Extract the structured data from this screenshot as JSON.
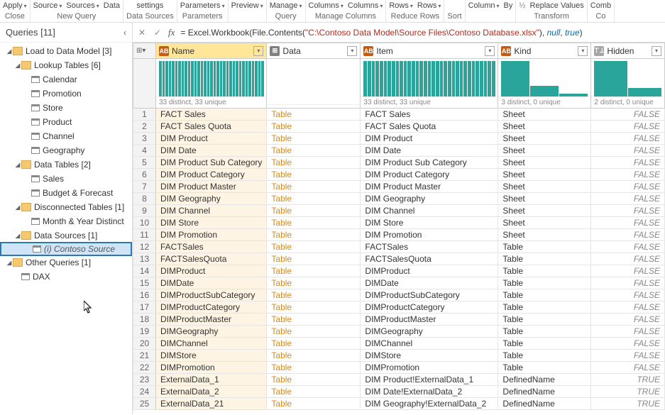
{
  "ribbon": {
    "groups": [
      {
        "top": [
          "Apply"
        ],
        "top_dd": [
          true
        ],
        "bottom": "Close"
      },
      {
        "top": [
          "Source",
          "Sources",
          "Data"
        ],
        "top_dd": [
          true,
          true,
          false
        ],
        "bottom": "New Query"
      },
      {
        "top": [
          "settings"
        ],
        "top_dd": [
          false
        ],
        "bottom": "Data Sources"
      },
      {
        "top": [
          "Parameters"
        ],
        "top_dd": [
          true
        ],
        "bottom": "Parameters"
      },
      {
        "top": [
          "Preview"
        ],
        "top_dd": [
          true
        ],
        "bottom": ""
      },
      {
        "top": [
          "Manage"
        ],
        "top_dd": [
          true
        ],
        "bottom": "Query"
      },
      {
        "top": [
          "Columns",
          "Columns"
        ],
        "top_dd": [
          true,
          true
        ],
        "bottom": "Manage Columns"
      },
      {
        "top": [
          "Rows",
          "Rows"
        ],
        "top_dd": [
          true,
          true
        ],
        "bottom": "Reduce Rows"
      },
      {
        "top": [
          ""
        ],
        "top_dd": [
          false
        ],
        "bottom": "Sort"
      },
      {
        "top": [
          "Column",
          "By"
        ],
        "top_dd": [
          true,
          false
        ],
        "bottom": ""
      },
      {
        "top": [
          "Replace Values"
        ],
        "top_dd": [
          false
        ],
        "bottom": "Transform",
        "prefix": "½"
      },
      {
        "top": [
          "Comb"
        ],
        "top_dd": [
          false
        ],
        "bottom": "Co"
      }
    ]
  },
  "queries_header": "Queries [11]",
  "tree": [
    {
      "level": 0,
      "type": "folder",
      "expanded": true,
      "label": "Load to Data Model [3]"
    },
    {
      "level": 1,
      "type": "folder",
      "expanded": true,
      "label": "Lookup Tables [6]"
    },
    {
      "level": 2,
      "type": "table",
      "label": "Calendar"
    },
    {
      "level": 2,
      "type": "table",
      "label": "Promotion"
    },
    {
      "level": 2,
      "type": "table",
      "label": "Store"
    },
    {
      "level": 2,
      "type": "table",
      "label": "Product"
    },
    {
      "level": 2,
      "type": "table",
      "label": "Channel"
    },
    {
      "level": 2,
      "type": "table",
      "label": "Geography"
    },
    {
      "level": 1,
      "type": "folder",
      "expanded": true,
      "label": "Data Tables [2]"
    },
    {
      "level": 2,
      "type": "table",
      "label": "Sales"
    },
    {
      "level": 2,
      "type": "table",
      "label": "Budget & Forecast"
    },
    {
      "level": 1,
      "type": "folder",
      "expanded": true,
      "label": "Disconnected Tables [1]"
    },
    {
      "level": 2,
      "type": "table",
      "label": "Month & Year Distinct"
    },
    {
      "level": 1,
      "type": "folder",
      "expanded": true,
      "label": "Data Sources [1]"
    },
    {
      "level": 2,
      "type": "table",
      "label": "(i) Contoso Source",
      "selected": true,
      "italic": true
    },
    {
      "level": 0,
      "type": "folder",
      "expanded": true,
      "label": "Other Queries [1]"
    },
    {
      "level": 1,
      "type": "table",
      "label": "DAX"
    }
  ],
  "formula": {
    "prefix": "= Excel.Workbook(File.Contents(",
    "string": "\"C:\\Contoso Data Model\\Source Files\\Contoso Database.xlsx\"",
    "mid": "), ",
    "null": "null",
    "sep": ", ",
    "true": "true",
    "suffix": ")"
  },
  "columns": [
    {
      "key": "name",
      "label": "Name",
      "type": "abc",
      "type_text": "AB",
      "selected": true
    },
    {
      "key": "data",
      "label": "Data",
      "type": "any",
      "type_text": "⊞"
    },
    {
      "key": "item",
      "label": "Item",
      "type": "abc",
      "type_text": "AB"
    },
    {
      "key": "kind",
      "label": "Kind",
      "type": "abc",
      "type_text": "AB"
    },
    {
      "key": "hidden",
      "label": "Hidden",
      "type": "bool",
      "type_text": "⊤⊥"
    }
  ],
  "histograms": {
    "name": {
      "caption": "33 distinct, 33 unique",
      "bars": 33,
      "heights": "full"
    },
    "data": {
      "caption": "",
      "bars": 0
    },
    "item": {
      "caption": "33 distinct, 33 unique",
      "bars": 33,
      "heights": "full"
    },
    "kind": {
      "caption": "3 distinct, 0 unique",
      "bars": 3,
      "heights": [
        50,
        15,
        4
      ]
    },
    "hidden": {
      "caption": "2 distinct, 0 unique",
      "bars": 2,
      "heights": [
        50,
        12
      ]
    }
  },
  "rows": [
    {
      "n": 1,
      "name": "FACT Sales",
      "data": "Table",
      "item": "FACT Sales",
      "kind": "Sheet",
      "hidden": "FALSE"
    },
    {
      "n": 2,
      "name": "FACT Sales Quota",
      "data": "Table",
      "item": "FACT Sales Quota",
      "kind": "Sheet",
      "hidden": "FALSE"
    },
    {
      "n": 3,
      "name": "DIM Product",
      "data": "Table",
      "item": "DIM Product",
      "kind": "Sheet",
      "hidden": "FALSE"
    },
    {
      "n": 4,
      "name": "DIM Date",
      "data": "Table",
      "item": "DIM Date",
      "kind": "Sheet",
      "hidden": "FALSE"
    },
    {
      "n": 5,
      "name": "DIM Product Sub Category",
      "data": "Table",
      "item": "DIM Product Sub Category",
      "kind": "Sheet",
      "hidden": "FALSE"
    },
    {
      "n": 6,
      "name": "DIM Product Category",
      "data": "Table",
      "item": "DIM Product Category",
      "kind": "Sheet",
      "hidden": "FALSE"
    },
    {
      "n": 7,
      "name": "DIM Product Master",
      "data": "Table",
      "item": "DIM Product Master",
      "kind": "Sheet",
      "hidden": "FALSE"
    },
    {
      "n": 8,
      "name": "DIM Geography",
      "data": "Table",
      "item": "DIM Geography",
      "kind": "Sheet",
      "hidden": "FALSE"
    },
    {
      "n": 9,
      "name": "DIM Channel",
      "data": "Table",
      "item": "DIM Channel",
      "kind": "Sheet",
      "hidden": "FALSE"
    },
    {
      "n": 10,
      "name": "DIM Store",
      "data": "Table",
      "item": "DIM Store",
      "kind": "Sheet",
      "hidden": "FALSE"
    },
    {
      "n": 11,
      "name": "DIM Promotion",
      "data": "Table",
      "item": "DIM Promotion",
      "kind": "Sheet",
      "hidden": "FALSE"
    },
    {
      "n": 12,
      "name": "FACTSales",
      "data": "Table",
      "item": "FACTSales",
      "kind": "Table",
      "hidden": "FALSE"
    },
    {
      "n": 13,
      "name": "FACTSalesQuota",
      "data": "Table",
      "item": "FACTSalesQuota",
      "kind": "Table",
      "hidden": "FALSE"
    },
    {
      "n": 14,
      "name": "DIMProduct",
      "data": "Table",
      "item": "DIMProduct",
      "kind": "Table",
      "hidden": "FALSE"
    },
    {
      "n": 15,
      "name": "DIMDate",
      "data": "Table",
      "item": "DIMDate",
      "kind": "Table",
      "hidden": "FALSE"
    },
    {
      "n": 16,
      "name": "DIMProductSubCategory",
      "data": "Table",
      "item": "DIMProductSubCategory",
      "kind": "Table",
      "hidden": "FALSE"
    },
    {
      "n": 17,
      "name": "DIMProductCategory",
      "data": "Table",
      "item": "DIMProductCategory",
      "kind": "Table",
      "hidden": "FALSE"
    },
    {
      "n": 18,
      "name": "DIMProductMaster",
      "data": "Table",
      "item": "DIMProductMaster",
      "kind": "Table",
      "hidden": "FALSE"
    },
    {
      "n": 19,
      "name": "DIMGeography",
      "data": "Table",
      "item": "DIMGeography",
      "kind": "Table",
      "hidden": "FALSE"
    },
    {
      "n": 20,
      "name": "DIMChannel",
      "data": "Table",
      "item": "DIMChannel",
      "kind": "Table",
      "hidden": "FALSE"
    },
    {
      "n": 21,
      "name": "DIMStore",
      "data": "Table",
      "item": "DIMStore",
      "kind": "Table",
      "hidden": "FALSE"
    },
    {
      "n": 22,
      "name": "DIMPromotion",
      "data": "Table",
      "item": "DIMPromotion",
      "kind": "Table",
      "hidden": "FALSE"
    },
    {
      "n": 23,
      "name": "ExternalData_1",
      "data": "Table",
      "item": "DIM Product!ExternalData_1",
      "kind": "DefinedName",
      "hidden": "TRUE"
    },
    {
      "n": 24,
      "name": "ExternalData_2",
      "data": "Table",
      "item": "DIM Date!ExternalData_2",
      "kind": "DefinedName",
      "hidden": "TRUE"
    },
    {
      "n": 25,
      "name": "ExternalData_21",
      "data": "Table",
      "item": "DIM Geography!ExternalData_2",
      "kind": "DefinedName",
      "hidden": "TRUE"
    }
  ]
}
